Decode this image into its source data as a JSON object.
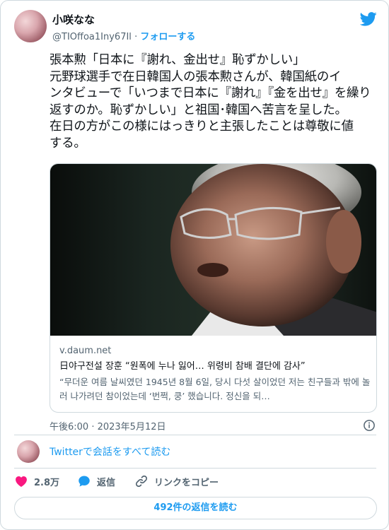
{
  "author": {
    "name": "小咲なな",
    "handle": "@TIOffoa1Iny67Il",
    "separator": "·",
    "follow_label": "フォローする"
  },
  "tweet": {
    "text": "張本勲「日本に『謝れ、金出せ』恥ずかしい」\n元野球選手で在日韓国人の張本勲さんが、韓国紙のイ\nンタビューで「いつまで日本に『謝れ』『金を出せ』を繰り\n返すのか。恥ずかしい」と祖国･韓国へ苦言を呈した。\n在日の方がこの様にはっきりと主張したことは尊敬に値\nする。"
  },
  "link_card": {
    "domain": "v.daum.net",
    "title": "日야구전설 장훈 “원폭에 누나 잃어… 위령비 참배 결단에 감사”",
    "description": "“무더운 여름 날씨였던 1945년 8월 6일, 당시 다섯 살이었던 저는 친구들과 밖에 놀러 나가려던 참이었는데 ‘번쩍, 쿵’ 했습니다. 정신을 되…"
  },
  "timestamp": "午後6:00 · 2023年5月12日",
  "conversation_link": "Twitterで会話をすべて読む",
  "actions": {
    "like_count": "2.8万",
    "reply_label": "返信",
    "copy_link_label": "リンクをコピー"
  },
  "read_replies_label": "492件の返信を読む",
  "colors": {
    "accent": "#1d9bf0",
    "like": "#f91880",
    "text": "#0f1419",
    "secondary": "#536471",
    "border": "#cfd9de"
  },
  "icons": [
    "twitter-bird-icon",
    "info-icon",
    "heart-icon",
    "reply-bubble-icon",
    "link-icon"
  ]
}
